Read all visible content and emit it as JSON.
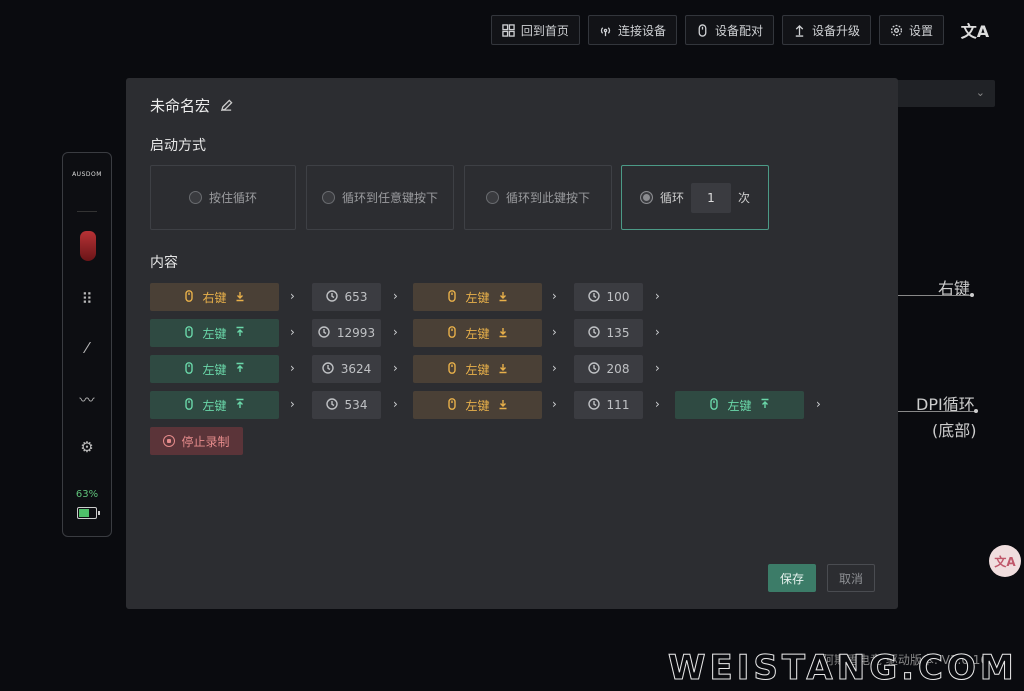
{
  "topnav": [
    {
      "label": "回到首页",
      "icon": "home-grid-icon"
    },
    {
      "label": "连接设备",
      "icon": "signal-icon"
    },
    {
      "label": "设备配对",
      "icon": "mouse-icon"
    },
    {
      "label": "设备升级",
      "icon": "upload-icon"
    },
    {
      "label": "设置",
      "icon": "gear-icon"
    }
  ],
  "sidebar": {
    "logo": "AUSDOM",
    "battery_pct": "63%",
    "battery_level": 0.63
  },
  "background": {
    "right_key_label": "右键",
    "dpi_label": "DPI循环",
    "dpi_sub": "(底部)",
    "footer": "阿斯盾电竞 驱动版本: V1.0.16",
    "watermark": "WEISTANG.COM",
    "fab_icon": "translate-icon"
  },
  "modal": {
    "title": "未命名宏",
    "start_mode_title": "启动方式",
    "start_options": [
      {
        "label": "按住循环",
        "selected": false
      },
      {
        "label": "循环到任意键按下",
        "selected": false
      },
      {
        "label": "循环到此键按下",
        "selected": false
      }
    ],
    "loop_option": {
      "label": "循环",
      "count": "1",
      "unit": "次",
      "selected": true
    },
    "content_title": "内容",
    "stop_label": "停止录制",
    "save_label": "保存",
    "cancel_label": "取消",
    "rows": [
      [
        {
          "type": "down",
          "label": "右键"
        },
        {
          "type": "delay",
          "label": "653"
        },
        {
          "type": "down",
          "label": "左键"
        },
        {
          "type": "delay",
          "label": "100"
        }
      ],
      [
        {
          "type": "up",
          "label": "左键"
        },
        {
          "type": "delay",
          "label": "12993"
        },
        {
          "type": "down",
          "label": "左键"
        },
        {
          "type": "delay",
          "label": "135"
        }
      ],
      [
        {
          "type": "up",
          "label": "左键"
        },
        {
          "type": "delay",
          "label": "3624"
        },
        {
          "type": "down",
          "label": "左键"
        },
        {
          "type": "delay",
          "label": "208"
        }
      ],
      [
        {
          "type": "up",
          "label": "左键"
        },
        {
          "type": "delay",
          "label": "534"
        },
        {
          "type": "down",
          "label": "左键"
        },
        {
          "type": "delay",
          "label": "111"
        },
        {
          "type": "up",
          "label": "左键"
        }
      ]
    ]
  }
}
